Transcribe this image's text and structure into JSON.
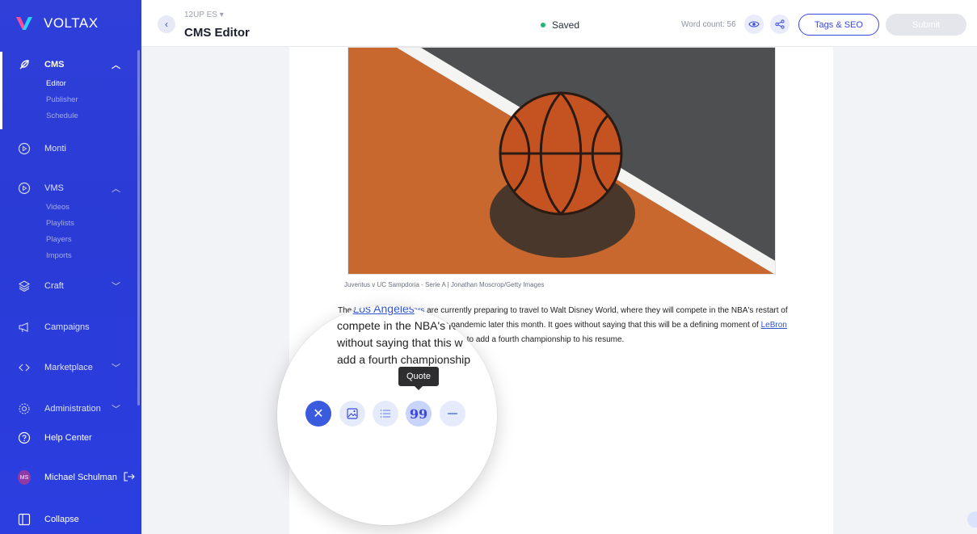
{
  "brand": {
    "name": "VOLTAX"
  },
  "sidebar": {
    "cms": {
      "label": "CMS",
      "chevron": "^",
      "items": [
        "Editor",
        "Publisher",
        "Schedule"
      ],
      "icon": "feather-icon"
    },
    "monti": {
      "label": "Monti",
      "icon": "play-circle-icon"
    },
    "vms": {
      "label": "VMS",
      "chevron": "^",
      "items": [
        "Videos",
        "Playlists",
        "Players",
        "Imports"
      ],
      "icon": "play-circle-icon"
    },
    "craft": {
      "label": "Craft",
      "chevron": "v",
      "icon": "layers-icon"
    },
    "campaigns": {
      "label": "Campaigns",
      "icon": "megaphone-icon"
    },
    "marketplace": {
      "label": "Marketplace",
      "chevron": "v",
      "icon": "code-icon"
    },
    "administration": {
      "label": "Administration",
      "chevron": "v",
      "icon": "gear-icon"
    },
    "help": {
      "label": "Help Center",
      "icon": "help-icon"
    },
    "user": {
      "initials": "MS",
      "name": "Michael Schulman"
    },
    "collapse": {
      "label": "Collapse"
    }
  },
  "topbar": {
    "site": "12UP ES",
    "title": "CMS Editor",
    "saved": "Saved",
    "word_count": "Word count: 56",
    "tags_label": "Tags & SEO",
    "submit_label": "Submit"
  },
  "article": {
    "caption": "Juventus v UC Sampdoria - Serie A | Jonathan Moscrop/Getty Images",
    "p_start": "The ",
    "link1": "Los Angeles Lakers",
    "p_mid": " are currently preparing to travel to Walt Disney World, where they will compete in the NBA's restart of operation amid the coronavirus pandemic later this month. It goes without saying that this will be a defining moment of ",
    "link2": "LeBron James' career",
    "p_end": ", as he will be looking to add a fourth championship to his resume."
  },
  "magnifier": {
    "line1_pre": "ne ",
    "line1_link": "Los Angeles",
    "line2": "compete in the NBA's re",
    "line3": "without saying that this w",
    "line4": "add a fourth championship",
    "tooltip": "Quote"
  },
  "colors": {
    "accent": "#3a49d9",
    "sidebar": "#2f3fd8",
    "saved_dot": "#22b573"
  }
}
